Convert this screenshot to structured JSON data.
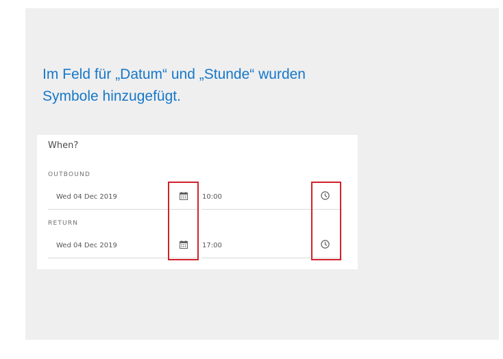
{
  "caption": {
    "line1": "Im Feld für „Datum“ und „Stunde“ wurden",
    "line2": "Symbole hinzugefügt."
  },
  "form": {
    "title": "When?",
    "outbound": {
      "label": "OUTBOUND",
      "date": "Wed 04 Dec 2019",
      "time": "10:00",
      "date_icon": "calendar-icon",
      "time_icon": "clock-icon"
    },
    "return": {
      "label": "RETURN",
      "date": "Wed 04 Dec 2019",
      "time": "17:00",
      "date_icon": "calendar-icon",
      "time_icon": "clock-icon"
    }
  },
  "colors": {
    "caption": "#1677c9",
    "highlight_border": "#d0202a",
    "slide_background": "#efefef"
  }
}
